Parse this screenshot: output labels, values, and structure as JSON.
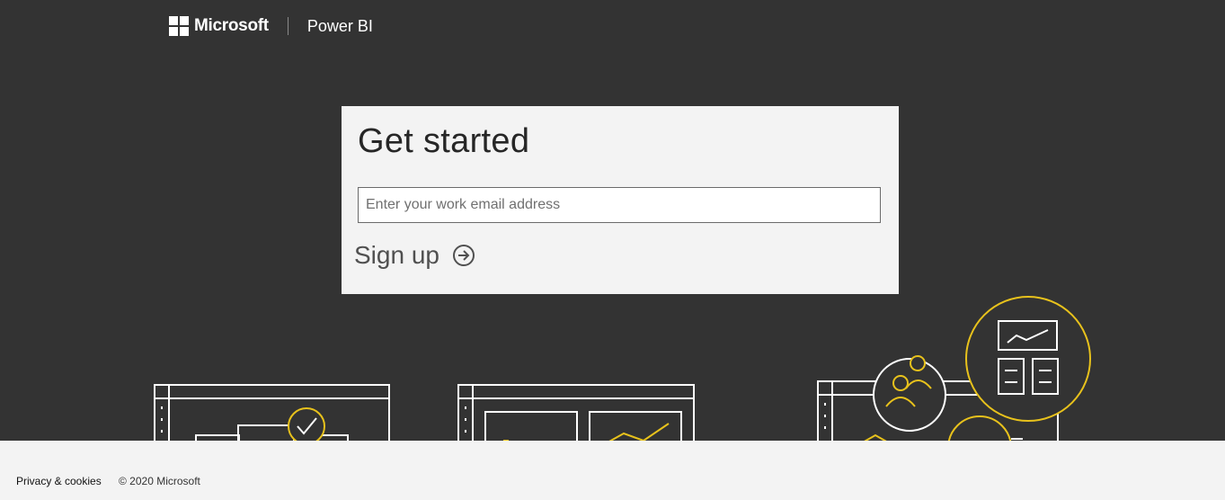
{
  "header": {
    "brand": "Microsoft",
    "product": "Power BI",
    "logo_icon": "microsoft-logo-icon"
  },
  "signup_card": {
    "title": "Get started",
    "email_placeholder": "Enter your work email address",
    "email_value": "",
    "signup_label": "Sign up",
    "signup_icon": "arrow-right-circle-icon"
  },
  "illustrations": [
    {
      "name": "dashboard-check-illustration",
      "icons": [
        "window-frame-icon",
        "check-circle-icon"
      ]
    },
    {
      "name": "report-chart-illustration",
      "icons": [
        "window-frame-icon",
        "line-chart-icon"
      ]
    },
    {
      "name": "team-dashboard-illustration",
      "icons": [
        "users-circle-icon",
        "dashboard-circle-icon"
      ]
    }
  ],
  "footer": {
    "privacy_label": "Privacy & cookies",
    "copyright": "© 2020 Microsoft"
  },
  "colors": {
    "background": "#333333",
    "card": "#f3f3f3",
    "accent_yellow": "#e8c21c",
    "line_art": "#ffffff",
    "footer_bg": "#f3f3f3"
  }
}
